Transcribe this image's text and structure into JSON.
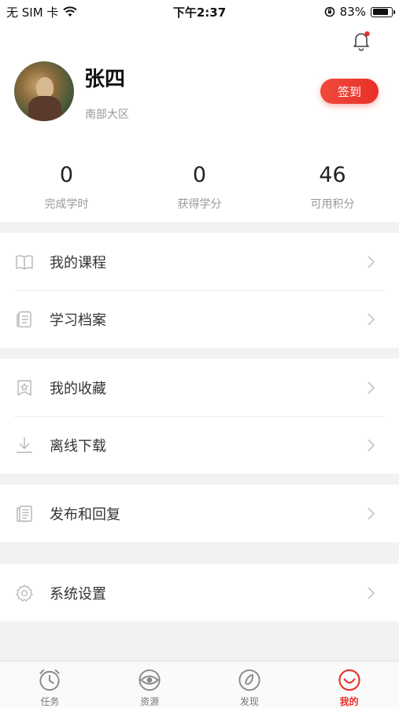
{
  "status_bar": {
    "carrier": "无 SIM 卡",
    "time": "下午2:37",
    "battery_percent": "83%",
    "battery_level": 0.83
  },
  "profile": {
    "name": "张四",
    "region": "南部大区",
    "checkin_label": "签到",
    "notification_dot": true
  },
  "stats": [
    {
      "value": "0",
      "label": "完成学时"
    },
    {
      "value": "0",
      "label": "获得学分"
    },
    {
      "value": "46",
      "label": "可用积分"
    }
  ],
  "menu_groups": [
    [
      {
        "label": "我的课程",
        "icon": "book-icon"
      },
      {
        "label": "学习档案",
        "icon": "document-icon"
      }
    ],
    [
      {
        "label": "我的收藏",
        "icon": "star-bookmark-icon"
      },
      {
        "label": "离线下载",
        "icon": "download-icon"
      }
    ],
    [
      {
        "label": "发布和回复",
        "icon": "notes-icon"
      }
    ],
    [
      {
        "label": "系统设置",
        "icon": "gear-icon"
      }
    ]
  ],
  "tabbar": {
    "tabs": [
      {
        "label": "任务",
        "icon": "clock-icon",
        "active": false
      },
      {
        "label": "资源",
        "icon": "eye-disc-icon",
        "active": false
      },
      {
        "label": "发现",
        "icon": "compass-icon",
        "active": false
      },
      {
        "label": "我的",
        "icon": "smile-icon",
        "active": true
      }
    ]
  },
  "colors": {
    "accent": "#e8302a",
    "background": "#f2f2f2",
    "icon_gray": "#b5b5b5"
  }
}
